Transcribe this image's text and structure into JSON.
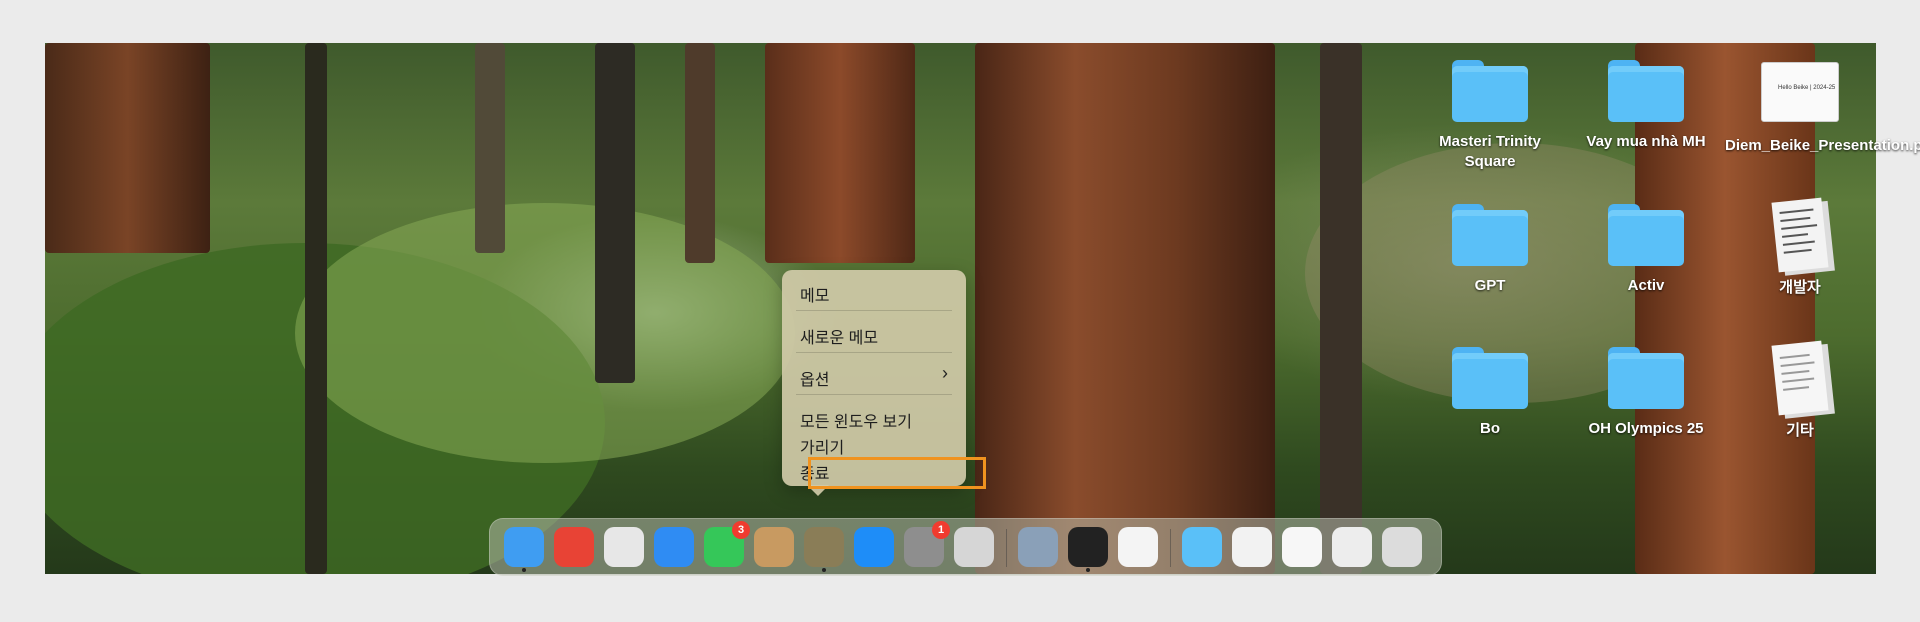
{
  "desktop_icons": [
    {
      "label": "Masteri Trinity Square",
      "kind": "folder"
    },
    {
      "label": "Vay mua nhà MH",
      "kind": "folder"
    },
    {
      "label": "Diem_Beike_Presentation.pptx",
      "kind": "document",
      "thumb_text": "Hello Beike | 2024-25"
    },
    {
      "label": "GPT",
      "kind": "folder"
    },
    {
      "label": "Activ",
      "kind": "folder"
    },
    {
      "label": "개발자",
      "kind": "file"
    },
    {
      "label": "Bo",
      "kind": "folder"
    },
    {
      "label": "OH Olympics 25",
      "kind": "folder"
    },
    {
      "label": "기타",
      "kind": "file"
    }
  ],
  "context_menu": {
    "items": [
      "메모",
      "새로운 메모",
      "옵션",
      "모든 윈도우 보기",
      "가리기",
      "종료"
    ],
    "submenu_arrow": "›",
    "highlighted_item": "종료"
  },
  "dock": {
    "apps": [
      {
        "name": "finder-icon",
        "color": "#3f9df2"
      },
      {
        "name": "chrome-icon",
        "color": "#e84335"
      },
      {
        "name": "launchpad-icon",
        "color": "#e7e7e7"
      },
      {
        "name": "safari-icon",
        "color": "#2f8cf3"
      },
      {
        "name": "messages-icon",
        "color": "#35c759",
        "badge": "3"
      },
      {
        "name": "contacts-icon",
        "color": "#c89a61"
      },
      {
        "name": "notes-icon",
        "color": "#8a7d57"
      },
      {
        "name": "app-store-icon",
        "color": "#1e8df8"
      },
      {
        "name": "system-settings-icon",
        "color": "#8e8e8e",
        "badge": "1"
      },
      {
        "name": "iphone-mirroring-icon",
        "color": "#d6d6d6"
      }
    ],
    "recent": [
      {
        "name": "preview-icon",
        "color": "#8aa0b8"
      },
      {
        "name": "activity-monitor-icon",
        "color": "#222222"
      },
      {
        "name": "textedit-icon",
        "color": "#f4f4f4"
      }
    ],
    "stacks": [
      {
        "name": "folder-stack-icon",
        "color": "#5ac0f8"
      },
      {
        "name": "document-stack-icon-1",
        "color": "#f2f2f2"
      },
      {
        "name": "document-stack-icon-2",
        "color": "#f7f7f7"
      },
      {
        "name": "document-stack-icon-3",
        "color": "#ededed"
      },
      {
        "name": "trash-icon",
        "color": "#dcdcdc"
      }
    ]
  }
}
